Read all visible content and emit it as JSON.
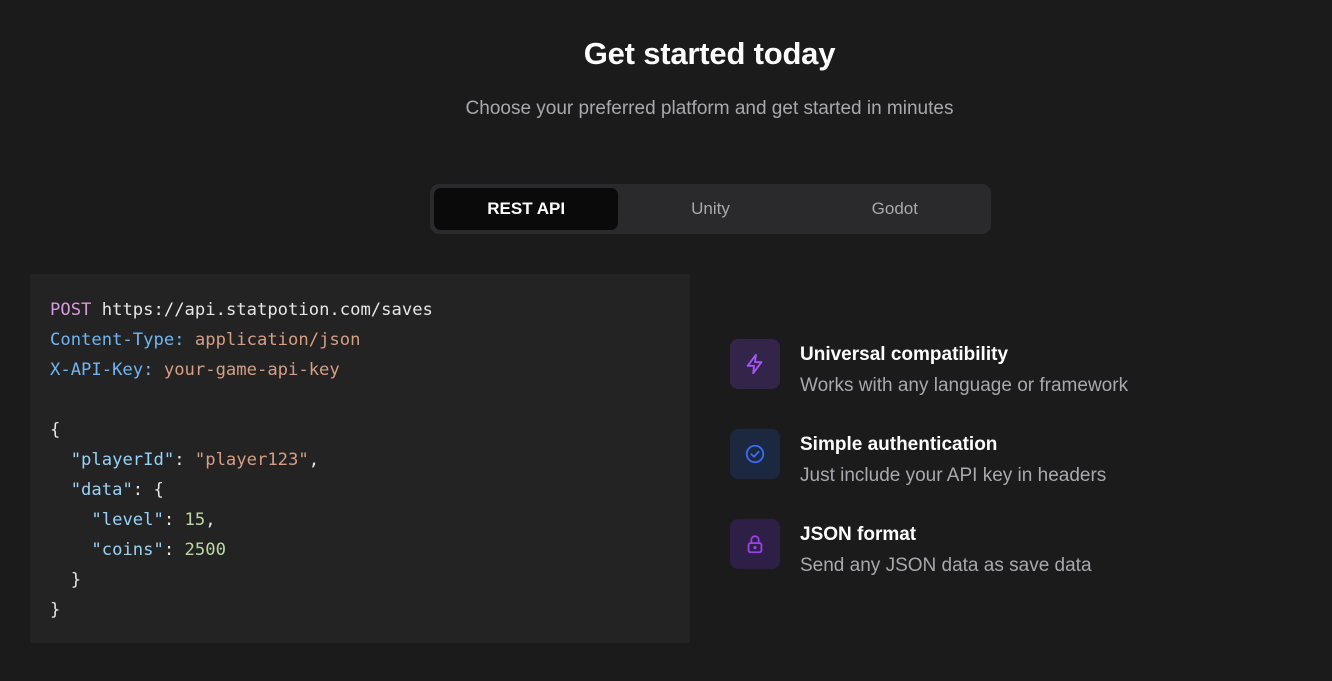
{
  "header": {
    "title": "Get started today",
    "subtitle": "Choose your preferred platform and get started in minutes"
  },
  "tabs": [
    {
      "label": "REST API",
      "active": true
    },
    {
      "label": "Unity",
      "active": false
    },
    {
      "label": "Godot",
      "active": false
    }
  ],
  "code": {
    "method": "POST",
    "url": "https://api.statpotion.com/saves",
    "headers": [
      {
        "name": "Content-Type:",
        "value": "application/json"
      },
      {
        "name": "X-API-Key:",
        "value": "your-game-api-key"
      }
    ],
    "body": {
      "player_key": "\"playerId\"",
      "player_value": "\"player123\"",
      "data_key": "\"data\"",
      "level_key": "\"level\"",
      "level_value": "15",
      "coins_key": "\"coins\"",
      "coins_value": "2500"
    }
  },
  "features": [
    {
      "icon": "lightning-icon",
      "title": "Universal compatibility",
      "description": "Works with any language or framework",
      "color": "#a855f7"
    },
    {
      "icon": "check-circle-icon",
      "title": "Simple authentication",
      "description": "Just include your API key in headers",
      "color": "#3b6cf0"
    },
    {
      "icon": "lock-icon",
      "title": "JSON format",
      "description": "Send any JSON data as save data",
      "color": "#9b3fe8"
    }
  ]
}
